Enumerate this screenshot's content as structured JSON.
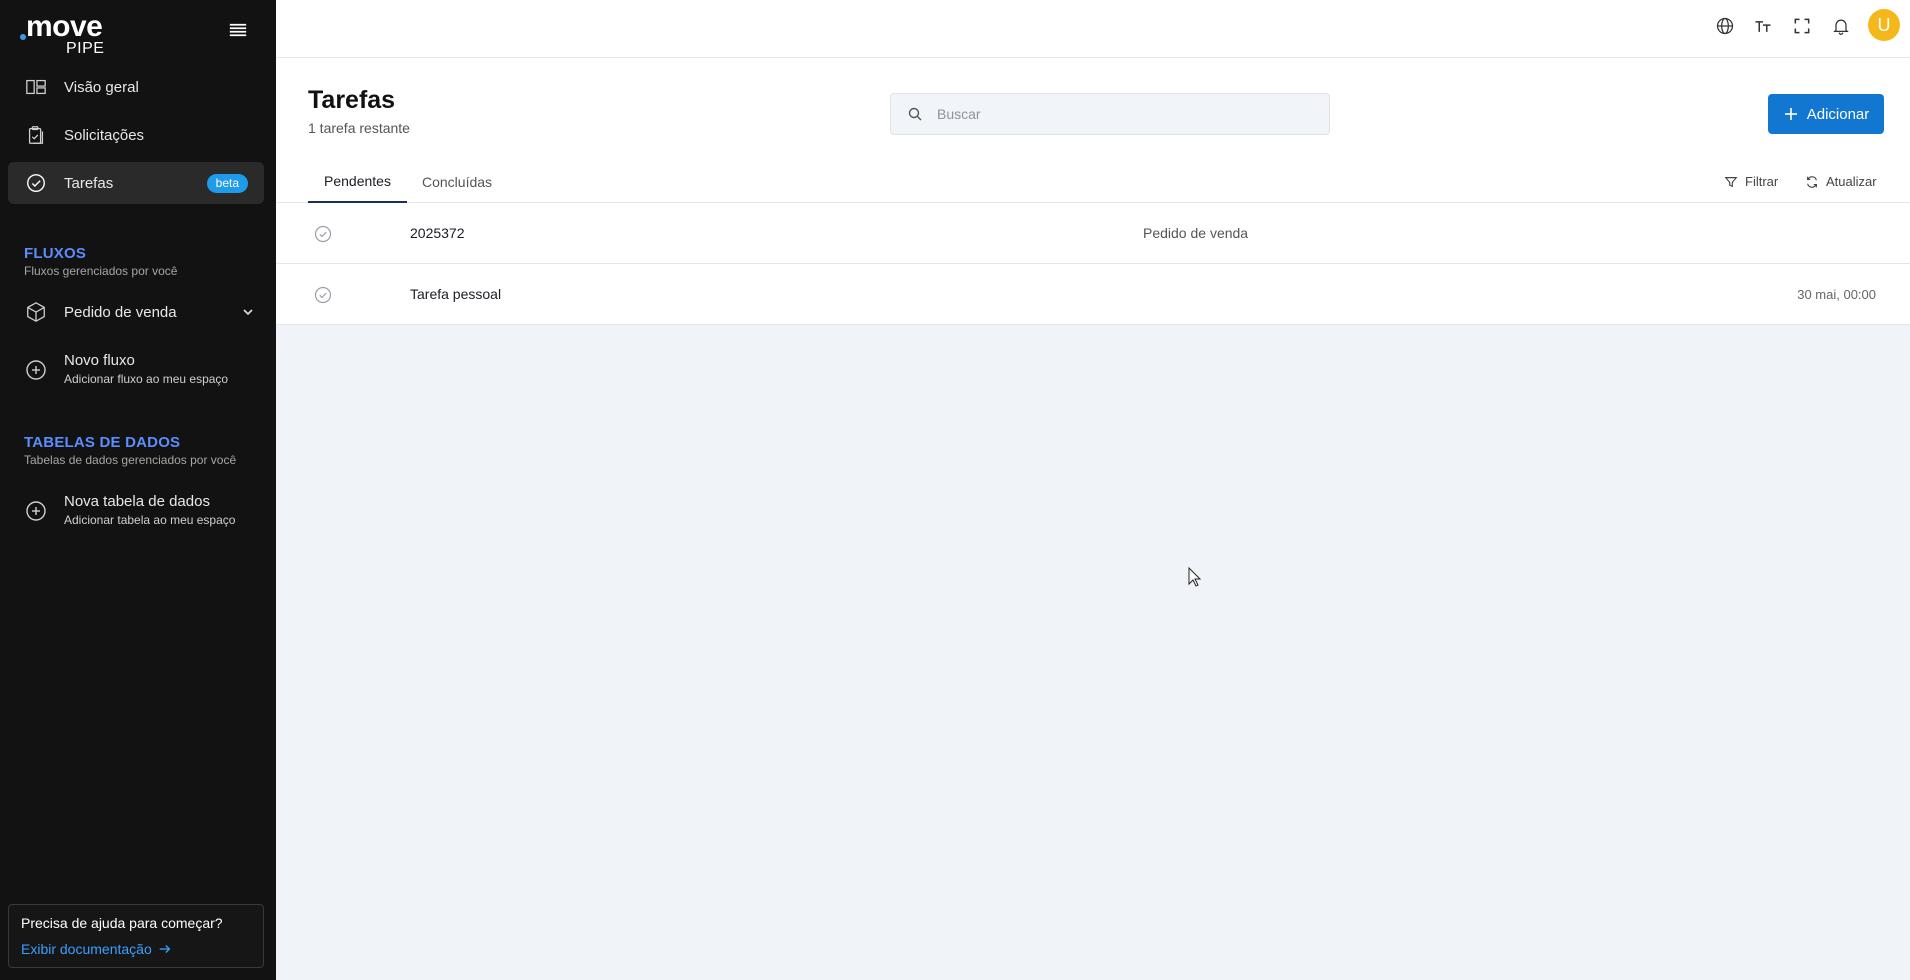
{
  "brand": {
    "logo_word": "move",
    "logo_sub": "PIPE"
  },
  "sidebar": {
    "nav": [
      {
        "label": "Visão geral",
        "icon": "dashboard-icon"
      },
      {
        "label": "Solicitações",
        "icon": "clipboard-icon"
      },
      {
        "label": "Tarefas",
        "icon": "check-circle-icon",
        "badge": "beta",
        "active": true
      }
    ],
    "flows_section": {
      "title": "FLUXOS",
      "subtitle": "Fluxos gerenciados por você"
    },
    "flows": [
      {
        "label": "Pedido de venda",
        "icon": "cube-icon"
      }
    ],
    "new_flow": {
      "title": "Novo fluxo",
      "desc": "Adicionar fluxo ao meu espaço"
    },
    "tables_section": {
      "title": "TABELAS DE DADOS",
      "subtitle": "Tabelas de dados gerenciados por você"
    },
    "new_table": {
      "title": "Nova tabela de dados",
      "desc": "Adicionar tabela ao meu espaço"
    },
    "help": {
      "question": "Precisa de ajuda para começar?",
      "link": "Exibir documentação"
    }
  },
  "topbar": {
    "icons": [
      "globe-icon",
      "text-size-icon",
      "fullscreen-icon",
      "bell-icon"
    ],
    "avatar_initial": "U"
  },
  "page": {
    "title": "Tarefas",
    "subtitle": "1 tarefa restante",
    "search_placeholder": "Buscar",
    "add_label": "Adicionar",
    "tabs": [
      {
        "label": "Pendentes",
        "active": true
      },
      {
        "label": "Concluídas",
        "active": false
      }
    ],
    "filter_label": "Filtrar",
    "refresh_label": "Atualizar"
  },
  "tasks": [
    {
      "name": "2025372",
      "flow": "Pedido de venda",
      "date": ""
    },
    {
      "name": "Tarefa pessoal",
      "flow": "",
      "date": "30 mai, 00:00"
    }
  ],
  "colors": {
    "sidebar_bg": "#121212",
    "accent": "#1277d1",
    "section_title": "#5b8dff",
    "badge": "#1e9be9",
    "avatar": "#f4b81a"
  }
}
